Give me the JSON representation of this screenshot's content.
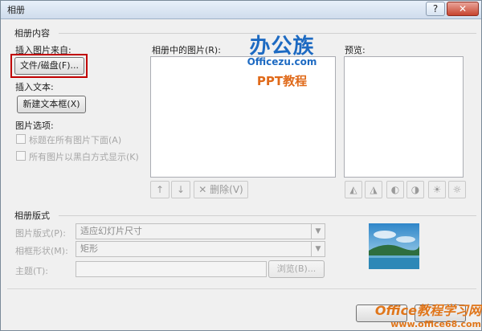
{
  "window": {
    "title": "相册",
    "help_glyph": "?",
    "close_glyph": "✕"
  },
  "content": {
    "group_label": "相册内容",
    "insert_from_label": "插入图片来自:",
    "file_disk_button": "文件/磁盘(F)...",
    "insert_text_label": "插入文本:",
    "new_textbox_button": "新建文本框(X)",
    "picture_options_label": "图片选项:",
    "option_caption_below": "标题在所有图片下面(A)",
    "option_all_bw": "所有图片以黑白方式显示(K)",
    "pictures_in_album_label": "相册中的图片(R):",
    "preview_label": "预览:",
    "move_up_glyph": "↑",
    "move_down_glyph": "↓",
    "remove_button": "删除(V)",
    "remove_glyph": "✕"
  },
  "layout_group": {
    "group_label": "相册版式",
    "picture_layout_label": "图片版式(P):",
    "picture_layout_value": "适应幻灯片尺寸",
    "frame_shape_label": "相框形状(M):",
    "frame_shape_value": "矩形",
    "theme_label": "主题(T):",
    "browse_button": "浏览(B)..."
  },
  "watermark": {
    "brand_big": "办公族",
    "brand_url": "Officezu.com",
    "brand_sub": "PPT教程",
    "bottom_line1": "Office教程学习网",
    "bottom_line2": "www.office68.com"
  },
  "colors": {
    "highlight": "#c00000",
    "brand_blue": "#1d6ac2",
    "brand_orange": "#e06a1a"
  }
}
